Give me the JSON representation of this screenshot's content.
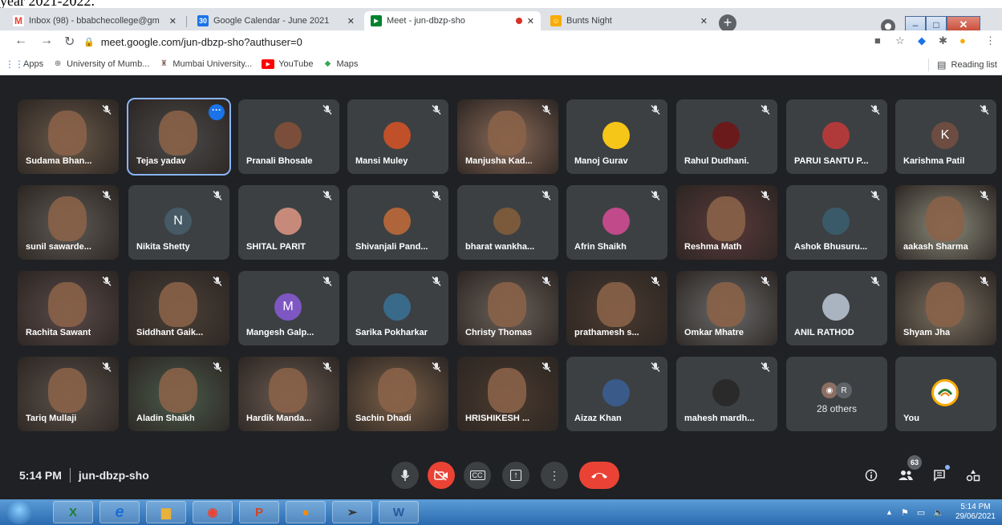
{
  "doc_text": "year 2021-2022.",
  "tabs": [
    {
      "label": "Inbox (98) - bbabchecollege@gm",
      "fav_color": "#ea4335",
      "fav_glyph": "M",
      "active": false
    },
    {
      "label": "Google Calendar - June 2021",
      "fav_color": "#1a73e8",
      "fav_glyph": "30",
      "active": false
    },
    {
      "label": "Meet - jun-dbzp-sho",
      "fav_color": "#00832d",
      "fav_glyph": "▶",
      "active": true
    },
    {
      "label": "Bunts Night",
      "fav_color": "#f9ab00",
      "fav_glyph": "☺",
      "active": false
    }
  ],
  "address": {
    "url": "meet.google.com/jun-dbzp-sho?authuser=0"
  },
  "bookmarks": [
    {
      "label": "Apps",
      "icon": "apps-grid-icon",
      "color": "#4285f4"
    },
    {
      "label": "University of Mumb...",
      "icon": "globe-icon",
      "color": "#5f6368"
    },
    {
      "label": "Mumbai University...",
      "icon": "university-icon",
      "color": "#8d6e63"
    },
    {
      "label": "YouTube",
      "icon": "youtube-icon",
      "color": "#ff0000"
    },
    {
      "label": "Maps",
      "icon": "maps-icon",
      "color": "#34a853"
    }
  ],
  "reading_list": "Reading list",
  "participants": [
    {
      "name": "Sudama Bhan...",
      "kind": "video",
      "color": "#6b5a4a"
    },
    {
      "name": "Tejas yadav",
      "kind": "video",
      "color": "#4a4a4a",
      "highlight": true
    },
    {
      "name": "Pranali Bhosale",
      "kind": "photo",
      "color": "#7a4e3a"
    },
    {
      "name": "Mansi Muley",
      "kind": "photo",
      "color": "#c0502a"
    },
    {
      "name": "Manjusha Kad...",
      "kind": "video",
      "color": "#8a6a58"
    },
    {
      "name": "Manoj Gurav",
      "kind": "photo",
      "color": "#f5c518"
    },
    {
      "name": "Rahul Dudhani.",
      "kind": "photo",
      "color": "#6a1a1a"
    },
    {
      "name": "PARUI SANTU P...",
      "kind": "photo",
      "color": "#b03a3a"
    },
    {
      "name": "Karishma Patil",
      "kind": "letter",
      "letter": "K",
      "color": "#6d4c41"
    },
    {
      "name": "sunil sawarde...",
      "kind": "video",
      "color": "#5e5a55"
    },
    {
      "name": "Nikita Shetty",
      "kind": "letter",
      "letter": "N",
      "color": "#455a64"
    },
    {
      "name": "SHITAL PARIT",
      "kind": "photo",
      "color": "#c78a7a"
    },
    {
      "name": "Shivanjali Pand...",
      "kind": "photo",
      "color": "#b0643a"
    },
    {
      "name": "bharat wankha...",
      "kind": "photo",
      "color": "#7a5a3a"
    },
    {
      "name": "Afrin Shaikh",
      "kind": "photo",
      "color": "#c04a8a"
    },
    {
      "name": "Reshma Math",
      "kind": "video",
      "color": "#5a3a3a"
    },
    {
      "name": "Ashok Bhusuru...",
      "kind": "photo",
      "color": "#3a5a6a"
    },
    {
      "name": "aakash Sharma",
      "kind": "video",
      "color": "#8a8a7a"
    },
    {
      "name": "Rachita Sawant",
      "kind": "video",
      "color": "#5a4a4a"
    },
    {
      "name": "Siddhant Gaik...",
      "kind": "video",
      "color": "#4a4036"
    },
    {
      "name": "Mangesh Galp...",
      "kind": "letter",
      "letter": "M",
      "color": "#7e57c2"
    },
    {
      "name": "Sarika Pokharkar",
      "kind": "photo",
      "color": "#3a6a8a"
    },
    {
      "name": "Christy Thomas",
      "kind": "video",
      "color": "#6a6058"
    },
    {
      "name": "prathamesh s...",
      "kind": "video",
      "color": "#4a3a30"
    },
    {
      "name": "Omkar Mhatre",
      "kind": "video",
      "color": "#6a6a6a"
    },
    {
      "name": "ANIL RATHOD",
      "kind": "photo",
      "color": "#aab4c0"
    },
    {
      "name": "Shyam Jha",
      "kind": "video",
      "color": "#7a7060"
    },
    {
      "name": "Tariq Mullaji",
      "kind": "video",
      "color": "#5a5048"
    },
    {
      "name": "Aladin Shaikh",
      "kind": "video",
      "color": "#4a5a4a"
    },
    {
      "name": "Hardik Manda...",
      "kind": "video",
      "color": "#6a5a50"
    },
    {
      "name": "Sachin Dhadi",
      "kind": "video",
      "color": "#7a6048"
    },
    {
      "name": "HRISHIKESH ...",
      "kind": "video",
      "color": "#4a3a2e"
    },
    {
      "name": "Aizaz Khan",
      "kind": "photo",
      "color": "#3a5a8a"
    },
    {
      "name": "mahesh mardh...",
      "kind": "photo",
      "color": "#2a2a2a"
    }
  ],
  "others_tile": {
    "label": "28 others",
    "avatar_letter": "R"
  },
  "you_tile": {
    "name": "You"
  },
  "bottom": {
    "time": "5:14 PM",
    "meeting_code": "jun-dbzp-sho",
    "people_badge": "63"
  },
  "taskbar": {
    "clock_time": "5:14 PM",
    "clock_date": "29/06/2021"
  },
  "colors": {
    "meet_bg": "#202124",
    "tile_bg": "#3c4043",
    "danger": "#ea4335",
    "accent": "#8ab4f8"
  }
}
